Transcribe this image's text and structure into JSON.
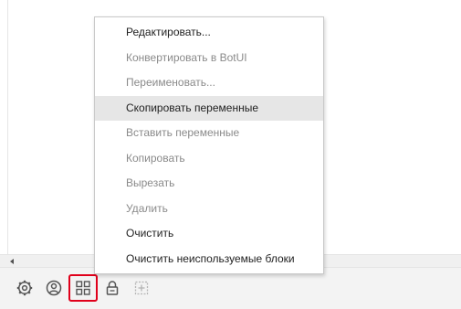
{
  "context_menu": {
    "items": [
      {
        "label": "Редактировать...",
        "enabled": true
      },
      {
        "label": "Конвертировать в BotUI",
        "enabled": false
      },
      {
        "label": "Переименовать...",
        "enabled": false
      },
      {
        "label": "Скопировать переменные",
        "enabled": true,
        "hovered": true
      },
      {
        "label": "Вставить переменные",
        "enabled": false
      },
      {
        "label": "Копировать",
        "enabled": false
      },
      {
        "label": "Вырезать",
        "enabled": false
      },
      {
        "label": "Удалить",
        "enabled": false
      },
      {
        "label": "Очистить",
        "enabled": true
      },
      {
        "label": "Очистить неиспользуемые блоки",
        "enabled": true
      }
    ]
  },
  "toolbar": {
    "buttons": [
      {
        "icon": "gear-icon"
      },
      {
        "icon": "user-circle-icon"
      },
      {
        "icon": "grid-icon",
        "highlighted": true
      },
      {
        "icon": "lock-icon"
      },
      {
        "icon": "add-block-icon",
        "enabled": false
      }
    ]
  },
  "colors": {
    "highlight_border": "#e0001b",
    "menu_hover": "#e6e6e6",
    "disabled_text": "#8a8a8a",
    "toolbar_bg": "#f3f3f3"
  }
}
